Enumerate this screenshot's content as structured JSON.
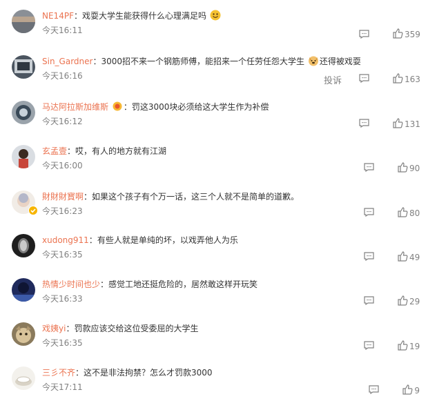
{
  "comments": [
    {
      "user": "NE14PF",
      "text": "戏耍大学生能获得什么心理满足吗",
      "time": "今天16:11",
      "likes": "359"
    },
    {
      "user": "Sin_Gardner",
      "text": "3000招不来一个钢筋师傅，能招来一个任劳任怨大学生",
      "text2": "还得被戏耍",
      "time": "今天16:16",
      "likes": "163",
      "report": "投诉"
    },
    {
      "user": "马达阿拉斯加维斯",
      "text": "罚这3000块必须给这大学生作为补偿",
      "time": "今天16:12",
      "likes": "131"
    },
    {
      "user": "玄孟壹",
      "text": "哎，有人的地方就有江湖",
      "time": "今天16:00",
      "likes": "90"
    },
    {
      "user": "財財財寳啊",
      "text": "如果这个孩子有个万一话，这三个人就不是简单的道歉。",
      "time": "今天16:23",
      "likes": "80"
    },
    {
      "user": "xudong911",
      "text": "有些人就是单纯的坏，以戏弄他人为乐",
      "time": "今天16:35",
      "likes": "49"
    },
    {
      "user": "热情少时间也少",
      "text": "感觉工地还挺危险的，居然敢这样开玩笑",
      "time": "今天16:33",
      "likes": "29"
    },
    {
      "user": "戏姨yi",
      "text": "罚款应该交给这位受委屈的大学生",
      "time": "今天16:35",
      "likes": "19"
    },
    {
      "user": "三彡不齐",
      "text": "这不是非法拘禁？怎么才罚款3000",
      "time": "今天17:11",
      "likes": "9"
    }
  ],
  "separator": "：",
  "colors": {
    "username": "#eb7350",
    "text": "#333333",
    "meta": "#808080"
  },
  "icons": {
    "reply": "comment-bubble-icon",
    "like": "thumbs-up-icon",
    "emoji": "smiley-emoji-icon",
    "verified": "verified-badge-icon"
  }
}
